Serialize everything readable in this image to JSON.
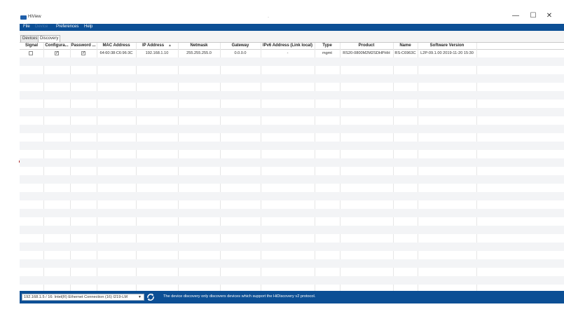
{
  "window": {
    "title": "HiView",
    "center_dot": "-",
    "minimize": "—",
    "maximize": "☐",
    "close": "✕"
  },
  "menu": {
    "file": "File",
    "device": "Device",
    "preferences": "Preferences",
    "help": "Help"
  },
  "tabs": [
    {
      "label": "Devices"
    },
    {
      "label": "Discovery"
    }
  ],
  "columns": {
    "signal": "Signal",
    "configurable": "Configura...",
    "password": "Password ...",
    "mac": "MAC Address",
    "ip": "IP Address",
    "ip_sort": "▲",
    "netmask": "Netmask",
    "gateway": "Gateway",
    "ipv6": "IPv6 Address (Link local)",
    "type": "Type",
    "product": "Product",
    "name": "Name",
    "software": "Software Version"
  },
  "rows": [
    {
      "signal": false,
      "configurable": true,
      "password": true,
      "mac": "64:60:38:C6:96:3C",
      "ip": "192.168.1.10",
      "netmask": "255.255.255.0",
      "gateway": "0.0.0.0",
      "ipv6": "-",
      "type": "mgmt",
      "product": "RS20-0800M2M2SDHPHH",
      "name": "RS-C6963C",
      "software": "L2P-09.1.00 2019-11-20 15:30"
    }
  ],
  "status": {
    "nic": "192.168.1.5 / 16: Intel(R) Ethernet Connection (16) I219-LM",
    "nic_arrow": "▼",
    "message": "The device discovery only discovers devices which support the HiDiscovery v2 protocol."
  },
  "colors": {
    "menubar": "#0c4f95",
    "statusbar": "#0c4f95",
    "stripe": "#f3f4f6"
  }
}
